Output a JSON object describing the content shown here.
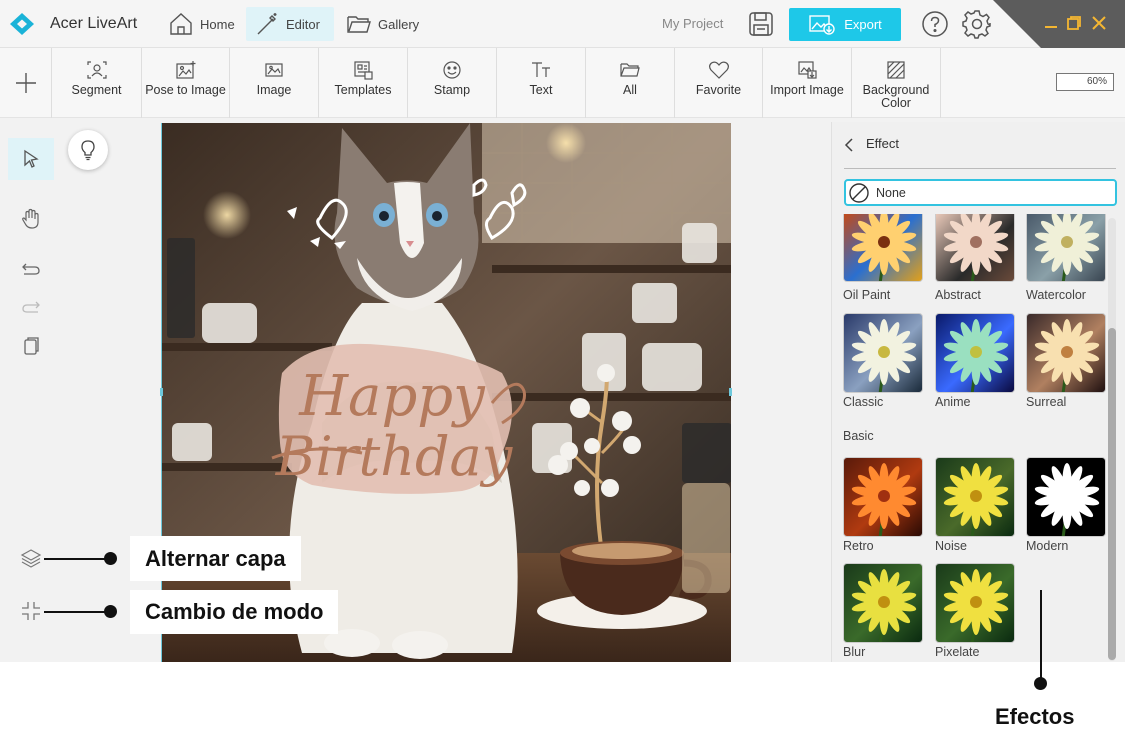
{
  "titlebar": {
    "app_name": "Acer LiveArt",
    "nav": [
      {
        "label": "Home"
      },
      {
        "label": "Editor"
      },
      {
        "label": "Gallery"
      }
    ],
    "project_name": "My Project",
    "export_label": "Export"
  },
  "toolbar": {
    "items": [
      {
        "label": "Segment"
      },
      {
        "label": "Pose to Image"
      },
      {
        "label": "Image"
      },
      {
        "label": "Templates"
      },
      {
        "label": "Stamp"
      },
      {
        "label": "Text"
      },
      {
        "label": "All"
      },
      {
        "label": "Favorite"
      },
      {
        "label": "Import Image"
      },
      {
        "label": "Background Color"
      }
    ],
    "zoom": "60%"
  },
  "canvas": {
    "sticker_line1": "Happy",
    "sticker_line2": "Birthday"
  },
  "panel": {
    "title": "Effect",
    "none_label": "None",
    "art_effects": [
      {
        "label": "Oil Paint"
      },
      {
        "label": "Abstract"
      },
      {
        "label": "Watercolor"
      },
      {
        "label": "Classic"
      },
      {
        "label": "Anime"
      },
      {
        "label": "Surreal"
      }
    ],
    "basic_section": "Basic",
    "basic_effects": [
      {
        "label": "Retro"
      },
      {
        "label": "Noise"
      },
      {
        "label": "Modern"
      },
      {
        "label": "Blur"
      },
      {
        "label": "Pixelate"
      }
    ]
  },
  "annotations": {
    "layer_toggle": "Alternar capa",
    "mode_change": "Cambio de modo",
    "effects": "Efectos"
  },
  "colors": {
    "accent": "#1ec8e8",
    "active_nav": "#dff3f8"
  }
}
